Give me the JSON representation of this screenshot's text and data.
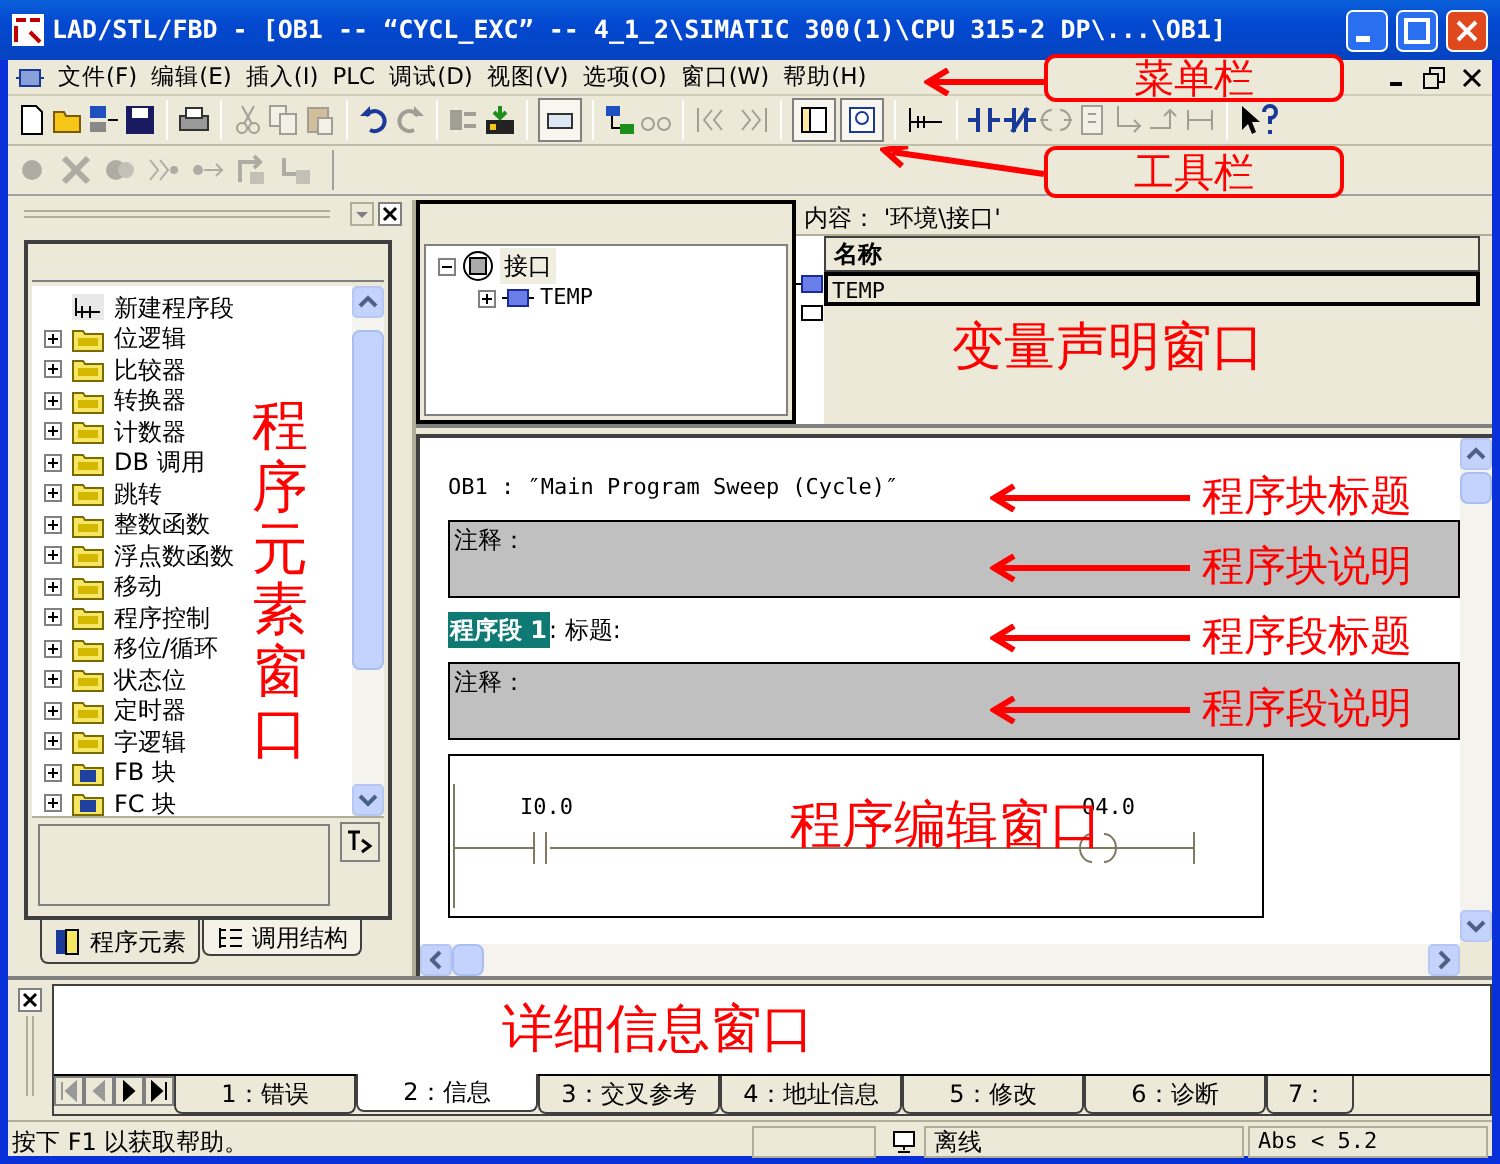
{
  "window": {
    "title": "LAD/STL/FBD  - [OB1 -- “CYCL_EXC” -- 4_1_2\\SIMATIC 300(1)\\CPU 315-2 DP\\...\\OB1]"
  },
  "menu": [
    "文件(F)",
    "编辑(E)",
    "插入(I)",
    "PLC",
    "调试(D)",
    "视图(V)",
    "选项(O)",
    "窗口(W)",
    "帮助(H)"
  ],
  "program_elements": {
    "items": [
      {
        "label": "新建程序段",
        "kind": "leaf"
      },
      {
        "label": "位逻辑",
        "kind": "folder",
        "expanded": false
      },
      {
        "label": "比较器",
        "kind": "folder",
        "expanded": false
      },
      {
        "label": "转换器",
        "kind": "folder",
        "expanded": false
      },
      {
        "label": "计数器",
        "kind": "folder",
        "expanded": false
      },
      {
        "label": "DB 调用",
        "kind": "folder",
        "expanded": false
      },
      {
        "label": "跳转",
        "kind": "folder",
        "expanded": false
      },
      {
        "label": "整数函数",
        "kind": "folder",
        "expanded": false
      },
      {
        "label": "浮点数函数",
        "kind": "folder",
        "expanded": false
      },
      {
        "label": "移动",
        "kind": "folder",
        "expanded": false
      },
      {
        "label": "程序控制",
        "kind": "folder",
        "expanded": false
      },
      {
        "label": "移位/循环",
        "kind": "folder",
        "expanded": false
      },
      {
        "label": "状态位",
        "kind": "folder",
        "expanded": false
      },
      {
        "label": "定时器",
        "kind": "folder",
        "expanded": false
      },
      {
        "label": "字逻辑",
        "kind": "folder",
        "expanded": false
      },
      {
        "label": "FB 块",
        "kind": "block",
        "expanded": false
      },
      {
        "label": "FC 块",
        "kind": "block",
        "expanded": false
      }
    ],
    "tabs": [
      {
        "label": "程序元素",
        "selected": true
      },
      {
        "label": "调用结构",
        "selected": false
      }
    ]
  },
  "interface_tree": {
    "label": "接口",
    "expanded": true,
    "children": [
      {
        "label": "TEMP",
        "expanded": false
      }
    ]
  },
  "declaration": {
    "content": "内容：  '环境\\接口'",
    "columns": [
      "名称"
    ],
    "rows": [
      {
        "name": "TEMP",
        "selected": true
      }
    ]
  },
  "editor": {
    "block_title": "OB1 :  ″Main Program Sweep (Cycle)″",
    "block_comment": "注释：",
    "network_label": "程序段 1",
    "network_title": ": 标题:",
    "network_comment": "注释：",
    "contact": "I0.0",
    "coil": "Q4.0"
  },
  "details": {
    "tabs": [
      {
        "label": "1：错误",
        "selected": false
      },
      {
        "label": "2：信息",
        "selected": true
      },
      {
        "label": "3：交叉参考",
        "selected": false
      },
      {
        "label": "4：地址信息",
        "selected": false
      },
      {
        "label": "5：修改",
        "selected": false
      },
      {
        "label": "6：诊断",
        "selected": false
      },
      {
        "label": "7：",
        "selected": false
      }
    ]
  },
  "status_bar": {
    "help": "按下 F1 以获取帮助。",
    "connection": "离线",
    "position": "Abs < 5.2"
  },
  "callouts": {
    "menu_bar": "菜单栏",
    "toolbar": "工具栏",
    "element_window": "程序元素窗口",
    "declaration_window": "变量声明窗口",
    "editor_labels": [
      "程序块标题",
      "程序块说明",
      "程序段标题",
      "程序段说明"
    ],
    "editor_window": "程序编辑窗口",
    "detail_window": "详细信息窗口"
  }
}
